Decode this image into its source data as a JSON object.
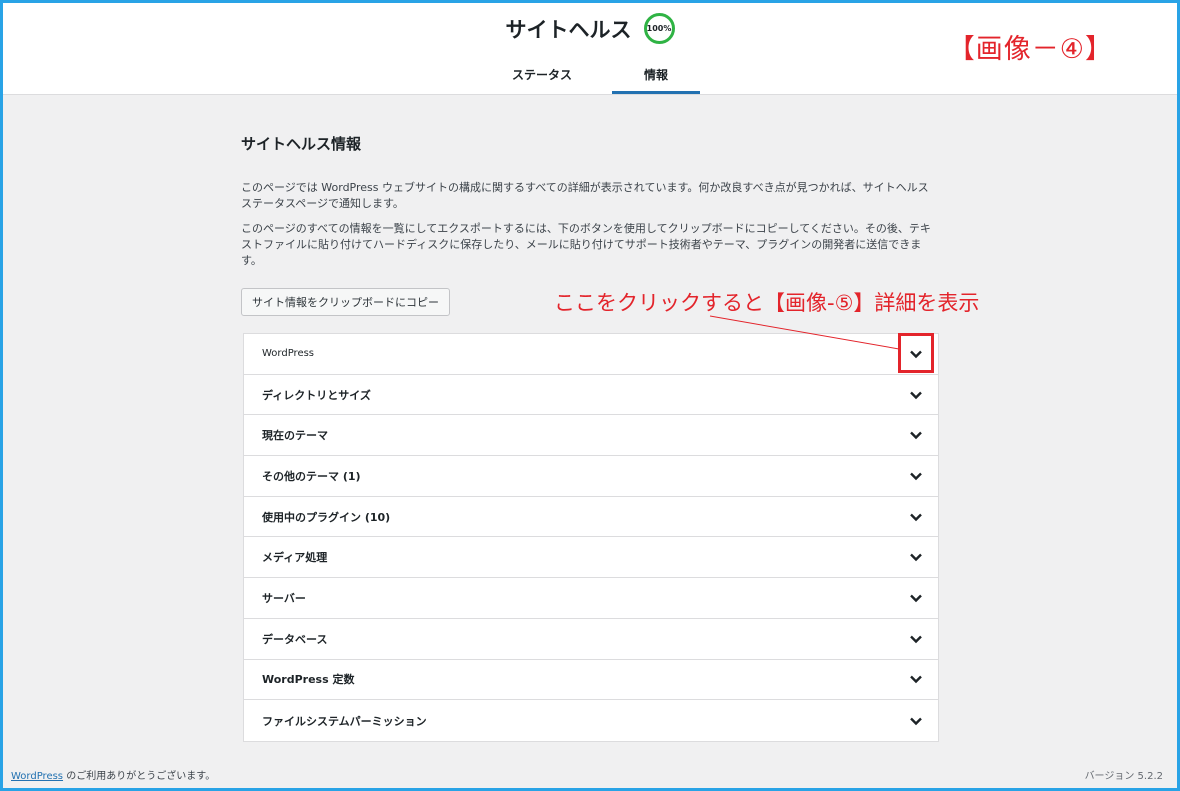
{
  "header": {
    "title": "サイトヘルス",
    "score": "100%",
    "tabs": [
      {
        "label": "ステータス",
        "active": false
      },
      {
        "label": "情報",
        "active": true
      }
    ]
  },
  "annotations": {
    "image_label": "【画像－④】",
    "click_hint": "ここをクリックすると【画像-⑤】詳細を表示",
    "color": "#e3242b"
  },
  "main": {
    "section_title": "サイトヘルス情報",
    "paragraph1": "このページでは WordPress ウェブサイトの構成に関するすべての詳細が表示されています。何か改良すべき点が見つかれば、サイトヘルスステータスページで通知します。",
    "paragraph2": "このページのすべての情報を一覧にしてエクスポートするには、下のボタンを使用してクリップボードにコピーしてください。その後、テキストファイルに貼り付けてハードディスクに保存したり、メールに貼り付けてサポート技術者やテーマ、プラグインの開発者に送信できます。",
    "copy_button": "サイト情報をクリップボードにコピー"
  },
  "accordion": {
    "items": [
      {
        "label": "WordPress"
      },
      {
        "label": "ディレクトリとサイズ"
      },
      {
        "label": "現在のテーマ"
      },
      {
        "label": "その他のテーマ (1)"
      },
      {
        "label": "使用中のプラグイン (10)"
      },
      {
        "label": "メディア処理"
      },
      {
        "label": "サーバー"
      },
      {
        "label": "データベース"
      },
      {
        "label": "WordPress 定数"
      },
      {
        "label": "ファイルシステムパーミッション"
      }
    ]
  },
  "footer": {
    "link_text": "WordPress",
    "thanks_text": " のご利用ありがとうございます。",
    "version": "バージョン 5.2.2"
  },
  "colors": {
    "frame_border": "#29a3e6",
    "active_tab": "#2271b1",
    "score_ring": "#2fb344"
  }
}
